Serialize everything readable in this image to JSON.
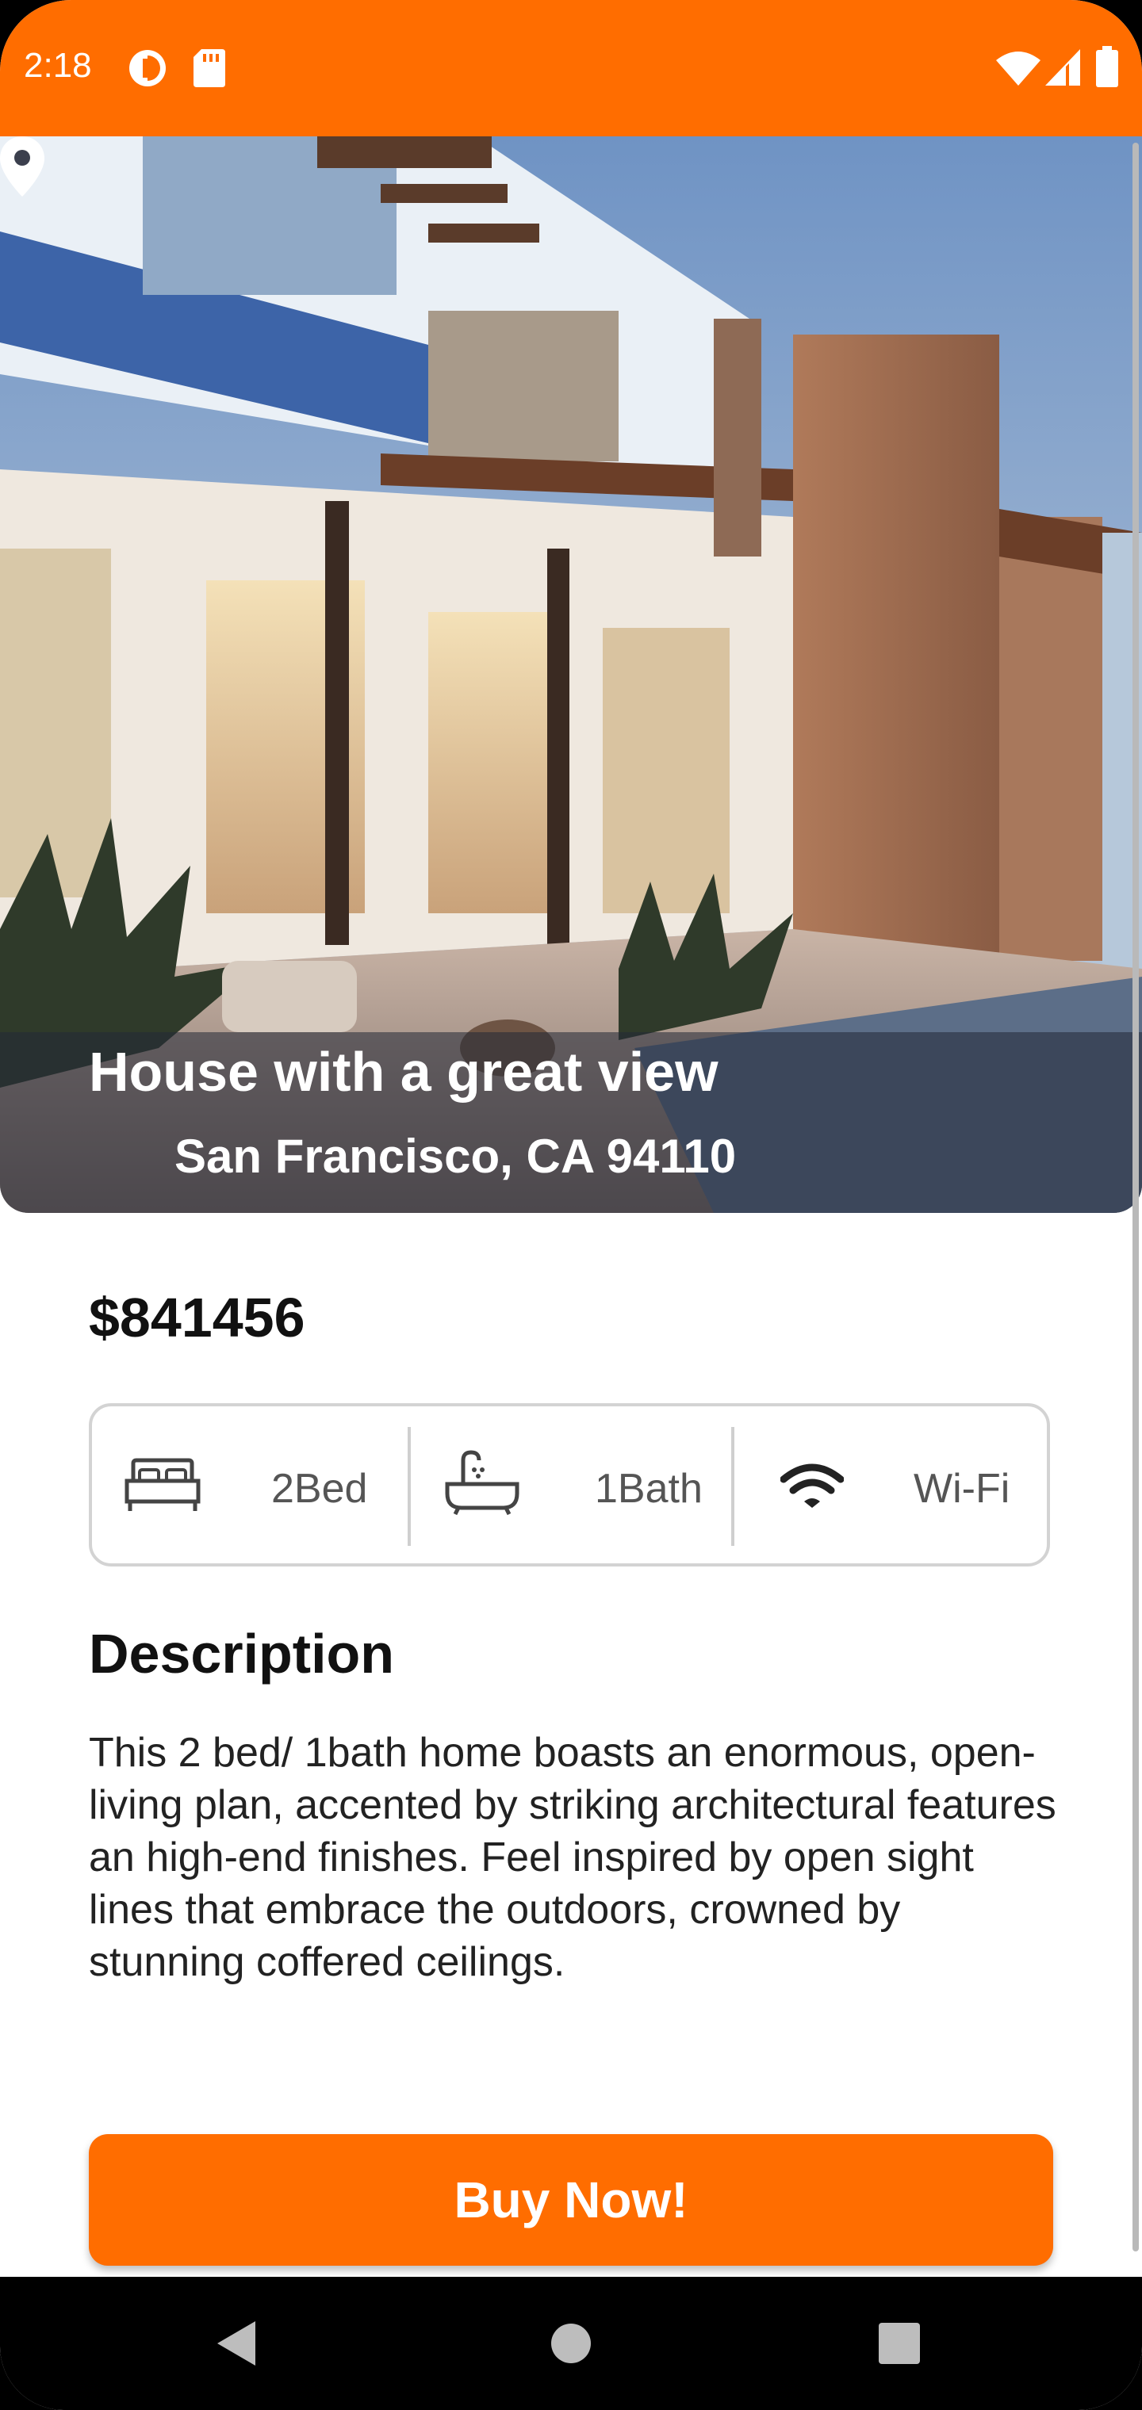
{
  "status_bar": {
    "time": "2:18",
    "background_color": "#ff6d00",
    "icons": [
      "data-saver-icon",
      "sd-card-icon",
      "wifi-icon",
      "cellular-signal-icon",
      "battery-icon"
    ]
  },
  "listing": {
    "title": "House with a great view",
    "location": "San Francisco, CA 94110",
    "price": "$841456",
    "amenities": [
      {
        "icon": "bed-icon",
        "label": "2Bed"
      },
      {
        "icon": "bathtub-icon",
        "label": "1Bath"
      },
      {
        "icon": "wifi-icon",
        "label": "Wi-Fi"
      }
    ],
    "description_title": "Description",
    "description": "This 2 bed/ 1bath home boasts an enormous, open-living plan, accented by striking architectural features an high-end finishes. Feel inspired by open sight lines that embrace the outdoors, crowned by stunning coffered ceilings."
  },
  "actions": {
    "buy_label": "Buy Now!"
  },
  "theme": {
    "accent": "#ff6d00",
    "text": "#111111",
    "muted_text": "#555555",
    "border": "#d3d3d3"
  },
  "nav_bar": {
    "buttons": [
      "back-icon",
      "home-icon",
      "recents-icon"
    ]
  }
}
